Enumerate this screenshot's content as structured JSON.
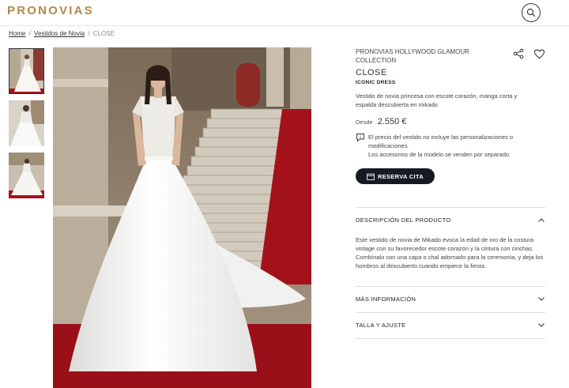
{
  "header": {
    "logo": "PRONOVIAS",
    "search_icon": "search-icon"
  },
  "breadcrumb": {
    "home": "Home",
    "sep1": "/",
    "category": "Vestidos de Novia",
    "sep2": "/",
    "current": "CLOSE"
  },
  "product": {
    "collection": "PRONOVIAS HOLLYWOOD GLAMOUR COLLECTION",
    "title": "CLOSE",
    "tag": "ICONIC DRESS",
    "short_description": "Vestido de novia princesa con escote corazón, manga corta y espalda descubierta en mikado",
    "price_label": "Desde",
    "price": "2.550 €",
    "note_line1": "El precio del vestido no incluye las personalizaciones o modificaciones",
    "note_line2": "Los accesorios de la modelo se venden por separado.",
    "reserve_button": "RESERVA CITA"
  },
  "accordion": {
    "description_title": "DESCRIPCIÓN DEL PRODUCTO",
    "description_body": "Este vestido de novia de Mikado evoca la edad de oro de la costura vintage con su favorecedor escote corazón y la cintura con cinchas. Combínalo con una capa o chal adornado para la ceremonia, y deja los hombros al descubierto cuando empiece la fiesta.",
    "more_info_title": "MÁS INFORMACIÓN",
    "size_title": "TALLA Y AJUSTE"
  },
  "colors": {
    "brand_gold": "#b08a4a",
    "button_dark": "#151a23",
    "carpet_red": "#a3121b"
  }
}
